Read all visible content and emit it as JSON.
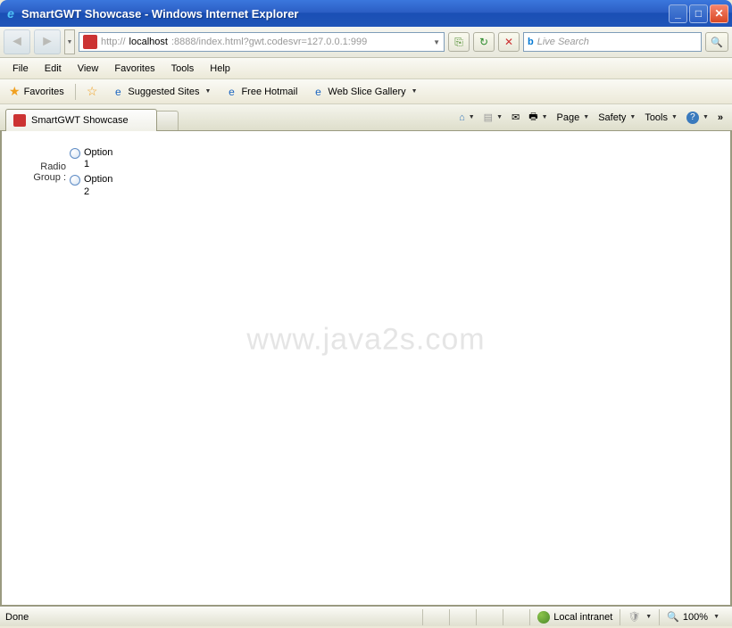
{
  "window": {
    "title": "SmartGWT Showcase - Windows Internet Explorer"
  },
  "nav": {
    "url_prefix": "http://",
    "url_host": "localhost",
    "url_rest": ":8888/index.html?gwt.codesvr=127.0.0.1:999",
    "search_placeholder": "Live Search"
  },
  "menu": {
    "items": [
      "File",
      "Edit",
      "View",
      "Favorites",
      "Tools",
      "Help"
    ]
  },
  "favbar": {
    "favorites": "Favorites",
    "suggested": "Suggested Sites",
    "hotmail": "Free Hotmail",
    "webslice": "Web Slice Gallery"
  },
  "tabs": {
    "active": "SmartGWT Showcase",
    "tools": {
      "page": "Page",
      "safety": "Safety",
      "tools": "Tools"
    }
  },
  "content": {
    "radio_label": "Radio Group :",
    "option1": "Option 1",
    "option2": "Option 2",
    "watermark": "www.java2s.com"
  },
  "status": {
    "text": "Done",
    "zone": "Local intranet",
    "zoom": "100%"
  }
}
